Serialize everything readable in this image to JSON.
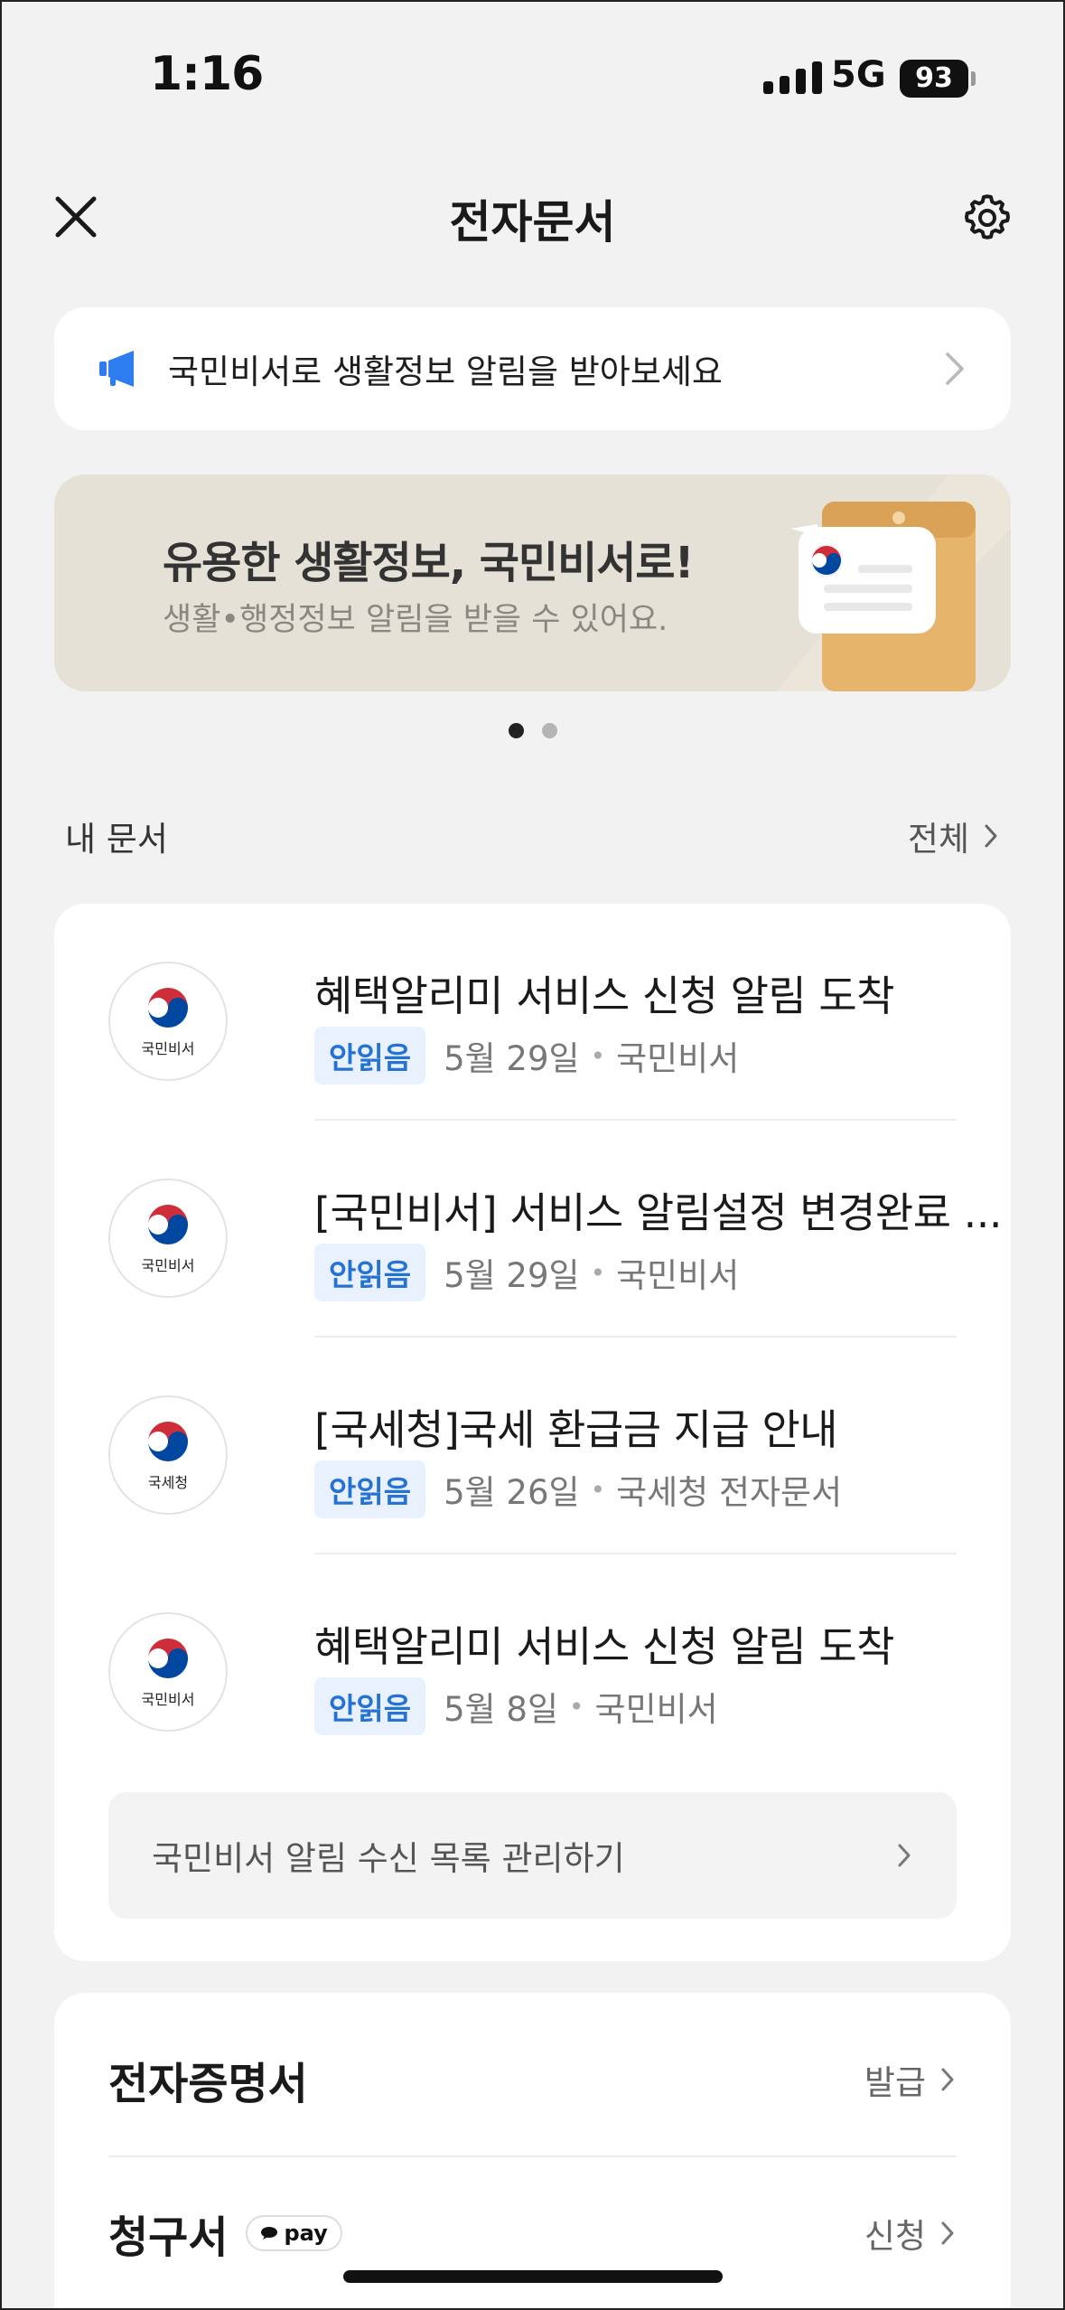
{
  "status_bar": {
    "time": "1:16",
    "network": "5G",
    "battery": "93"
  },
  "header": {
    "title": "전자문서"
  },
  "notice": {
    "text": "국민비서로 생활정보 알림을 받아보세요"
  },
  "promo": {
    "title": "유용한 생활정보, 국민비서로!",
    "subtitle": "생활•행정정보 알림을 받을 수 있어요.",
    "page_count": 2,
    "active_page": 1
  },
  "my_docs": {
    "title": "내 문서",
    "more_label": "전체",
    "items": [
      {
        "avatar_label": "국민비서",
        "title": "혜택알리미 서비스 신청 알림 도착",
        "badge": "안읽음",
        "date": "5월 29일",
        "sender": "국민비서"
      },
      {
        "avatar_label": "국민비서",
        "title": "[국민비서] 서비스 알림설정 변경완료 ...",
        "badge": "안읽음",
        "date": "5월 29일",
        "sender": "국민비서"
      },
      {
        "avatar_label": "국세청",
        "title": "[국세청]국세 환급금 지급 안내",
        "badge": "안읽음",
        "date": "5월 26일",
        "sender": "국세청 전자문서"
      },
      {
        "avatar_label": "국민비서",
        "title": "혜택알리미 서비스 신청 알림 도착",
        "badge": "안읽음",
        "date": "5월 8일",
        "sender": "국민비서"
      }
    ],
    "manage_label": "국민비서 알림 수신 목록 관리하기"
  },
  "services": [
    {
      "title": "전자증명서",
      "action": "발급"
    },
    {
      "title": "청구서",
      "badge": "pay",
      "action": "신청"
    }
  ],
  "colors": {
    "accent_blue": "#2572d6",
    "badge_bg": "#e8f1fd",
    "background": "#f2f2f3",
    "promo_bg": "#e6e1d7"
  }
}
